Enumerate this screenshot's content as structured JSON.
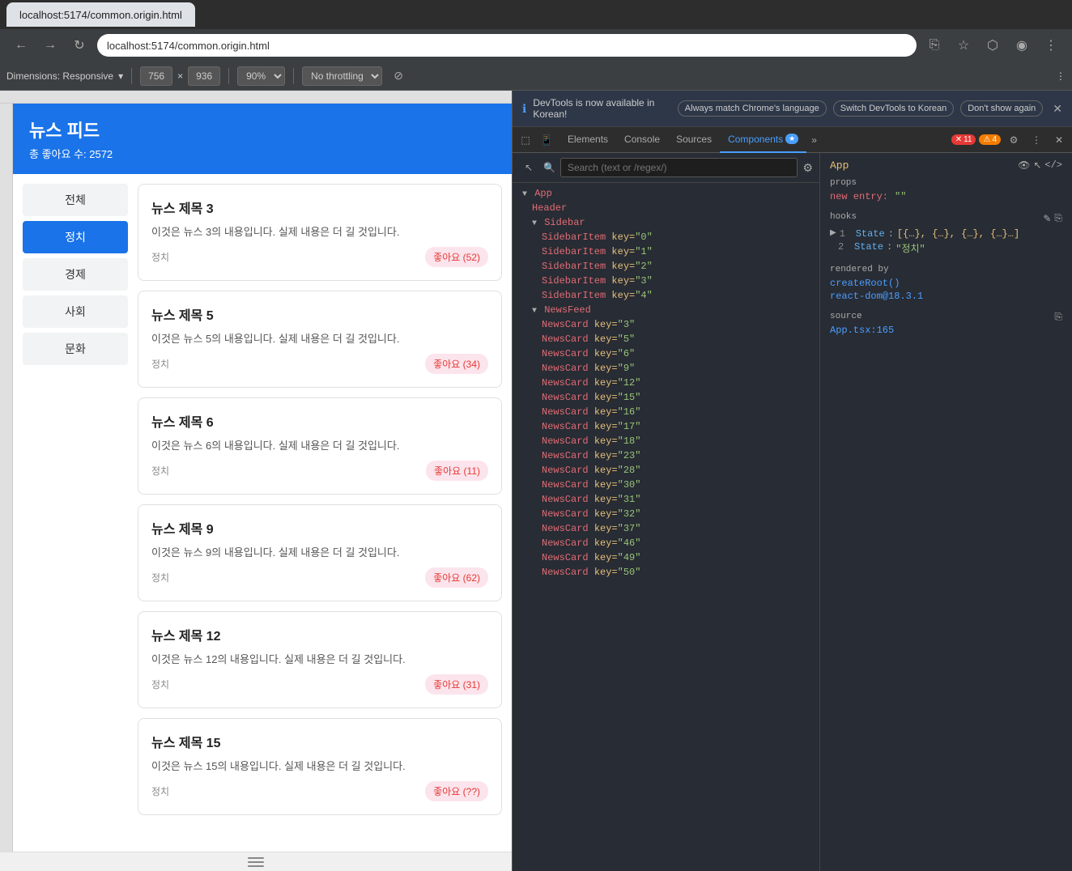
{
  "browser": {
    "tab_label": "localhost:5174/common.origin.html",
    "address": "localhost:5174/common.origin.html",
    "dimensions": "Dimensions: Responsive",
    "width": "756",
    "height": "936",
    "zoom": "90%",
    "throttling": "No throttling"
  },
  "news_app": {
    "title": "뉴스 피드",
    "subtitle": "총 좋아요 수: 2572",
    "sidebar_items": [
      {
        "label": "전체",
        "active": false
      },
      {
        "label": "정치",
        "active": true
      },
      {
        "label": "경제",
        "active": false
      },
      {
        "label": "사회",
        "active": false
      },
      {
        "label": "문화",
        "active": false
      }
    ],
    "news_cards": [
      {
        "title": "뉴스 제목 3",
        "content": "이것은 뉴스 3의 내용입니다. 실제 내용은 더 길 것입니다.",
        "category": "정치",
        "likes": "좋아요 (52)"
      },
      {
        "title": "뉴스 제목 5",
        "content": "이것은 뉴스 5의 내용입니다. 실제 내용은 더 길 것입니다.",
        "category": "정치",
        "likes": "좋아요 (34)"
      },
      {
        "title": "뉴스 제목 6",
        "content": "이것은 뉴스 6의 내용입니다. 실제 내용은 더 길 것입니다.",
        "category": "정치",
        "likes": "좋아요 (11)"
      },
      {
        "title": "뉴스 제목 9",
        "content": "이것은 뉴스 9의 내용입니다. 실제 내용은 더 길 것입니다.",
        "category": "정치",
        "likes": "좋아요 (62)"
      },
      {
        "title": "뉴스 제목 12",
        "content": "이것은 뉴스 12의 내용입니다. 실제 내용은 더 길 것입니다.",
        "category": "정치",
        "likes": "좋아요 (31)"
      },
      {
        "title": "뉴스 제목 15",
        "content": "이것은 뉴스 15의 내용입니다. 실제 내용은 더 길 것입니다.",
        "category": "정치",
        "likes": "좋아요 (??)"
      }
    ]
  },
  "devtools": {
    "notification": {
      "text": "DevTools is now available in Korean!",
      "btn1": "Always match Chrome's language",
      "btn2": "Switch DevTools to Korean",
      "btn3": "Don't show again"
    },
    "tabs": [
      "Elements",
      "Console",
      "Sources",
      "Components"
    ],
    "active_tab": "Components",
    "error_count": "11",
    "warn_count": "4",
    "search_placeholder": "Search (text or /regex/)",
    "tree": {
      "app": "App",
      "header": "Header",
      "sidebar": "Sidebar",
      "sidebar_items": [
        {
          "key": "0"
        },
        {
          "key": "1"
        },
        {
          "key": "2"
        },
        {
          "key": "3"
        },
        {
          "key": "4"
        }
      ],
      "newsfeed": "NewsFeed",
      "news_cards": [
        {
          "key": "3"
        },
        {
          "key": "5"
        },
        {
          "key": "6"
        },
        {
          "key": "9"
        },
        {
          "key": "12"
        },
        {
          "key": "15"
        },
        {
          "key": "16"
        },
        {
          "key": "17"
        },
        {
          "key": "18"
        },
        {
          "key": "23"
        },
        {
          "key": "28"
        },
        {
          "key": "30"
        },
        {
          "key": "31"
        },
        {
          "key": "32"
        },
        {
          "key": "37"
        },
        {
          "key": "46"
        },
        {
          "key": "49"
        },
        {
          "key": "50"
        }
      ]
    },
    "right_panel": {
      "component_name": "App",
      "props_title": "props",
      "props_new_entry": "new entry:",
      "props_val": "\"\"",
      "hooks_title": "hooks",
      "hook1_num": "1",
      "hook1_key": "State",
      "hook1_val": "[{…}, {…}, {…}, {…}…]",
      "hook2_num": "2",
      "hook2_key": "State",
      "hook2_val": "\"정치\"",
      "rendered_by_title": "rendered by",
      "rendered_by_1": "createRoot()",
      "rendered_by_2": "react-dom@18.3.1",
      "source_title": "source",
      "source_path": "App.tsx:165"
    }
  }
}
